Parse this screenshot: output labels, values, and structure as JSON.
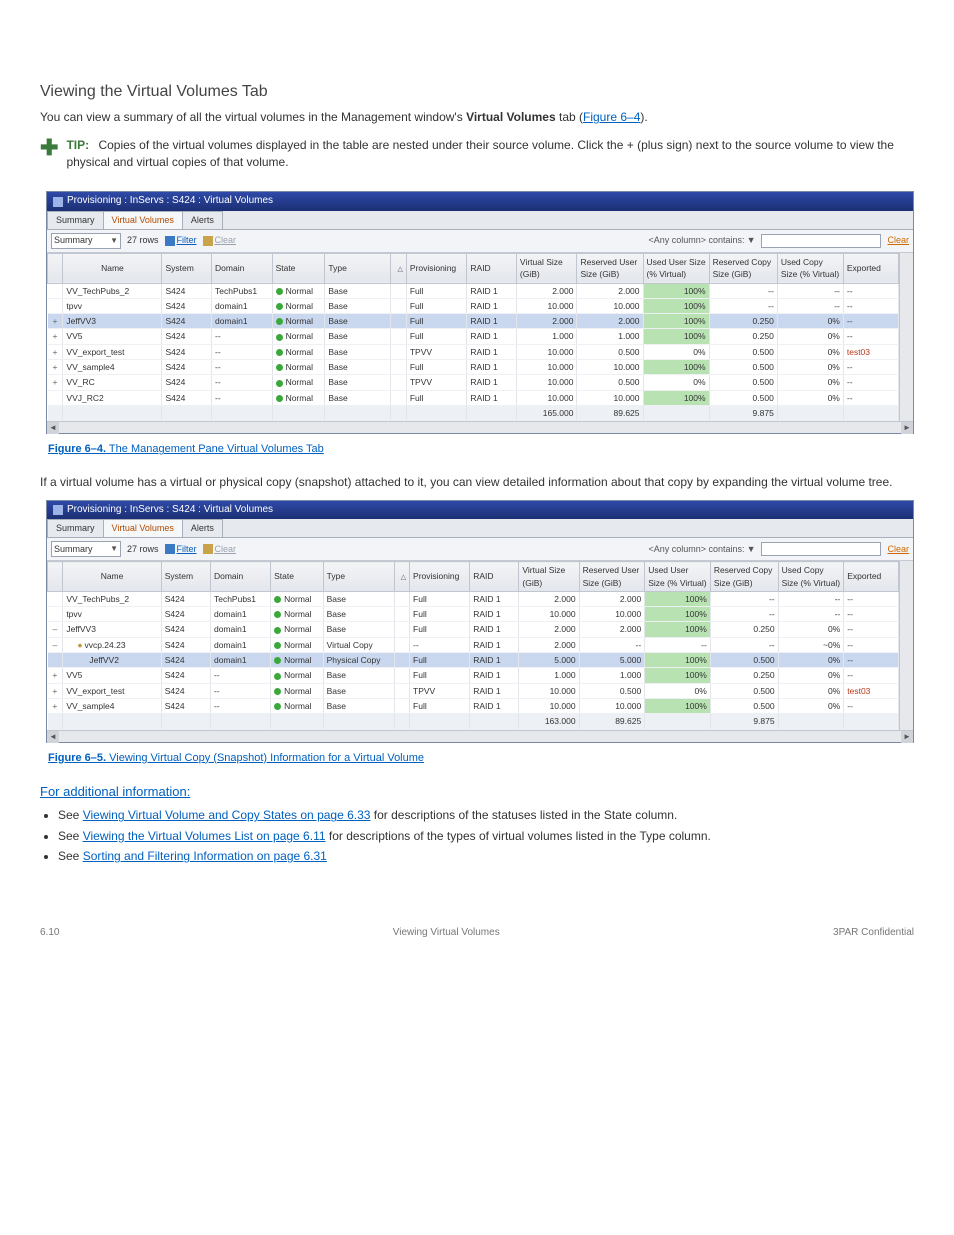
{
  "heading": "Viewing the Virtual Volumes Tab",
  "intro_pre": "You can view a summary of all the virtual volumes in the Management window's ",
  "intro_bold": "Virtual Volumes",
  "intro_post": " tab (",
  "intro_linktext": "Figure 6–4",
  "intro_after": ").",
  "tip": {
    "label": "TIP:",
    "text": "Copies of the virtual volumes displayed in the table are nested under their source volume. Click the + (plus sign) next to the source volume to view the physical and virtual copies of that volume."
  },
  "fig1": {
    "title": "Provisioning : InServs : S424 : Virtual Volumes",
    "tabs": [
      "Summary",
      "Virtual Volumes",
      "Alerts"
    ],
    "combo": "Summary",
    "rowcount": "27 rows",
    "filter": "Filter",
    "clear": "Clear",
    "anycol": "<Any column> contains:",
    "clear2": "Clear",
    "headers": [
      "",
      "Name",
      "System",
      "Domain",
      "State",
      "Type",
      "",
      "Provisioning",
      "RAID",
      "Virtual Size (GiB)",
      "Reserved User Size (GiB)",
      "Used User Size (% Virtual)",
      "Reserved Copy Size (GiB)",
      "Used Copy Size (% Virtual)",
      "Exported"
    ],
    "rows": [
      {
        "exp": "",
        "name": "VV_TechPubs_2",
        "sys": "S424",
        "dom": "TechPubs1",
        "state": "Normal",
        "type": "Base",
        "prov": "Full",
        "raid": "RAID 1",
        "vs": "2.000",
        "rus": "2.000",
        "uus": "100%",
        "uusbar": 100,
        "rcs": "--",
        "ucs": "--",
        "expd": "--"
      },
      {
        "exp": "",
        "name": "tpvv",
        "sys": "S424",
        "dom": "domain1",
        "state": "Normal",
        "type": "Base",
        "prov": "Full",
        "raid": "RAID 1",
        "vs": "10.000",
        "rus": "10.000",
        "uus": "100%",
        "uusbar": 100,
        "rcs": "--",
        "ucs": "--",
        "expd": "--"
      },
      {
        "exp": "+",
        "name": "JeffVV3",
        "sys": "S424",
        "dom": "domain1",
        "state": "Normal",
        "type": "Base",
        "prov": "Full",
        "raid": "RAID 1",
        "vs": "2.000",
        "rus": "2.000",
        "uus": "100%",
        "uusbar": 100,
        "rcs": "0.250",
        "ucs": "0%",
        "expd": "--",
        "sel": true
      },
      {
        "exp": "+",
        "name": "VV5",
        "sys": "S424",
        "dom": "--",
        "state": "Normal",
        "type": "Base",
        "prov": "Full",
        "raid": "RAID 1",
        "vs": "1.000",
        "rus": "1.000",
        "uus": "100%",
        "uusbar": 100,
        "rcs": "0.250",
        "ucs": "0%",
        "expd": "--"
      },
      {
        "exp": "+",
        "name": "VV_export_test",
        "sys": "S424",
        "dom": "--",
        "state": "Normal",
        "type": "Base",
        "prov": "TPVV",
        "raid": "RAID 1",
        "vs": "10.000",
        "rus": "0.500",
        "uus": "0%",
        "uusbar": 0,
        "rcs": "0.500",
        "ucs": "0%",
        "expd": "test03",
        "expred": true
      },
      {
        "exp": "+",
        "name": "VV_sample4",
        "sys": "S424",
        "dom": "--",
        "state": "Normal",
        "type": "Base",
        "prov": "Full",
        "raid": "RAID 1",
        "vs": "10.000",
        "rus": "10.000",
        "uus": "100%",
        "uusbar": 100,
        "rcs": "0.500",
        "ucs": "0%",
        "expd": "--"
      },
      {
        "exp": "+",
        "name": "VV_RC",
        "sys": "S424",
        "dom": "--",
        "state": "Normal",
        "type": "Base",
        "prov": "TPVV",
        "raid": "RAID 1",
        "vs": "10.000",
        "rus": "0.500",
        "uus": "0%",
        "uusbar": 0,
        "rcs": "0.500",
        "ucs": "0%",
        "expd": "--"
      },
      {
        "exp": "",
        "name": "VVJ_RC2",
        "sys": "S424",
        "dom": "--",
        "state": "Normal",
        "type": "Base",
        "prov": "Full",
        "raid": "RAID 1",
        "vs": "10.000",
        "rus": "10.000",
        "uus": "100%",
        "uusbar": 100,
        "rcs": "0.500",
        "ucs": "0%",
        "expd": "--"
      }
    ],
    "totals": {
      "vs": "165.000",
      "rus": "89.625",
      "rcs": "9.875"
    },
    "caption_no": "Figure 6–4.",
    "caption": "  The Management Pane Virtual Volumes Tab"
  },
  "mid_text": "If a virtual volume has a virtual or physical copy (snapshot) attached to it, you can view detailed information about that copy by expanding the virtual volume tree.",
  "fig2": {
    "title": "Provisioning : InServs : S424 : Virtual Volumes",
    "tabs": [
      "Summary",
      "Virtual Volumes",
      "Alerts"
    ],
    "combo": "Summary",
    "rowcount": "27 rows",
    "filter": "Filter",
    "clear": "Clear",
    "anycol": "<Any column> contains:",
    "clear2": "Clear",
    "headers": [
      "",
      "Name",
      "System",
      "Domain",
      "State",
      "Type",
      "",
      "Provisioning",
      "RAID",
      "Virtual Size (GiB)",
      "Reserved User Size (GiB)",
      "Used User Size (% Virtual)",
      "Reserved Copy Size (GiB)",
      "Used Copy Size (% Virtual)",
      "Exported"
    ],
    "rows": [
      {
        "exp": "",
        "name": "VV_TechPubs_2",
        "sys": "S424",
        "dom": "TechPubs1",
        "state": "Normal",
        "type": "Base",
        "prov": "Full",
        "raid": "RAID 1",
        "vs": "2.000",
        "rus": "2.000",
        "uus": "100%",
        "uusbar": 100,
        "rcs": "--",
        "ucs": "--",
        "expd": "--"
      },
      {
        "exp": "",
        "name": "tpvv",
        "sys": "S424",
        "dom": "domain1",
        "state": "Normal",
        "type": "Base",
        "prov": "Full",
        "raid": "RAID 1",
        "vs": "10.000",
        "rus": "10.000",
        "uus": "100%",
        "uusbar": 100,
        "rcs": "--",
        "ucs": "--",
        "expd": "--"
      },
      {
        "exp": "–",
        "name": "JeffVV3",
        "sys": "S424",
        "dom": "domain1",
        "state": "Normal",
        "type": "Base",
        "prov": "Full",
        "raid": "RAID 1",
        "vs": "2.000",
        "rus": "2.000",
        "uus": "100%",
        "uusbar": 100,
        "rcs": "0.250",
        "ucs": "0%",
        "expd": "--"
      },
      {
        "exp": "–",
        "name": "vvcp.24.23",
        "sys": "S424",
        "dom": "domain1",
        "state": "Normal",
        "type": "Virtual Copy",
        "prov": "--",
        "raid": "RAID 1",
        "vs": "2.000",
        "rus": "--",
        "uus": "--",
        "uusbar": null,
        "rcs": "--",
        "ucs": "~0%",
        "expd": "--",
        "indent": 1,
        "dot": true
      },
      {
        "exp": "",
        "name": "JeffVV2",
        "sys": "S424",
        "dom": "domain1",
        "state": "Normal",
        "type": "Physical Copy",
        "prov": "Full",
        "raid": "RAID 1",
        "vs": "5.000",
        "rus": "5.000",
        "uus": "100%",
        "uusbar": 100,
        "rcs": "0.500",
        "ucs": "0%",
        "expd": "--",
        "indent": 2,
        "sel": true
      },
      {
        "exp": "+",
        "name": "VV5",
        "sys": "S424",
        "dom": "--",
        "state": "Normal",
        "type": "Base",
        "prov": "Full",
        "raid": "RAID 1",
        "vs": "1.000",
        "rus": "1.000",
        "uus": "100%",
        "uusbar": 100,
        "rcs": "0.250",
        "ucs": "0%",
        "expd": "--"
      },
      {
        "exp": "+",
        "name": "VV_export_test",
        "sys": "S424",
        "dom": "--",
        "state": "Normal",
        "type": "Base",
        "prov": "TPVV",
        "raid": "RAID 1",
        "vs": "10.000",
        "rus": "0.500",
        "uus": "0%",
        "uusbar": 0,
        "rcs": "0.500",
        "ucs": "0%",
        "expd": "test03",
        "expred": true
      },
      {
        "exp": "+",
        "name": "VV_sample4",
        "sys": "S424",
        "dom": "--",
        "state": "Normal",
        "type": "Base",
        "prov": "Full",
        "raid": "RAID 1",
        "vs": "10.000",
        "rus": "10.000",
        "uus": "100%",
        "uusbar": 100,
        "rcs": "0.500",
        "ucs": "0%",
        "expd": "--"
      }
    ],
    "totals": {
      "vs": "163.000",
      "rus": "89.625",
      "rcs": "9.875"
    },
    "caption_no": "Figure 6–5.",
    "caption": "  Viewing Virtual Copy (Snapshot) Information for a Virtual Volume"
  },
  "bottom": {
    "lead": "For additional information:",
    "see": "See ",
    "b1a": "Viewing Virtual Volume and Copy States",
    "b1b": " on page 6.33",
    "b1c": " for descriptions of the statuses listed in the State column.",
    "b2a": "Viewing the Virtual Volumes List",
    "b2b": " on page 6.11",
    "b2c": " for descriptions of the types of virtual volumes listed in the Type column.",
    "b3a": "Sorting and Filtering Information",
    "b3b": " on page 6.31"
  },
  "footer": {
    "left": "6.10",
    "center": "Viewing Virtual Volumes",
    "right": "3PAR Confidential"
  }
}
